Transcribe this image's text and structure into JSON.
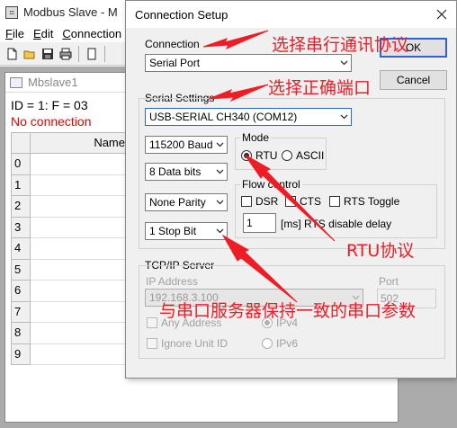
{
  "app": {
    "title": "Modbus Slave - M",
    "menu": [
      "File",
      "Edit",
      "Connection"
    ],
    "child_title": "Mbslave1",
    "status_line": "ID = 1: F = 03",
    "connection_status": "No connection",
    "grid": {
      "column_header": "Name",
      "row_indices": [
        "0",
        "1",
        "2",
        "3",
        "4",
        "5",
        "6",
        "7",
        "8",
        "9"
      ]
    }
  },
  "dialog": {
    "title": "Connection Setup",
    "connection_label": "Connection",
    "connection_value": "Serial Port",
    "ok_label": "OK",
    "cancel_label": "Cancel",
    "serial_settings_label": "Serial Settings",
    "port_value": "USB-SERIAL CH340 (COM12)",
    "baud_value": "115200 Baud",
    "data_bits_value": "8 Data bits",
    "parity_value": "None Parity",
    "stop_bits_value": "1 Stop Bit",
    "mode": {
      "label": "Mode",
      "rtu_label": "RTU",
      "ascii_label": "ASCII",
      "selected": "RTU"
    },
    "flow_control": {
      "label": "Flow control",
      "dsr_label": "DSR",
      "cts_label": "CTS",
      "rts_toggle_label": "RTS Toggle",
      "delay_value": "1",
      "delay_suffix": "[ms] RTS disable delay"
    },
    "tcpip": {
      "label": "TCP/IP Server",
      "ip_label": "IP Address",
      "ip_value": "192.168.3.100",
      "port_label": "Port",
      "port_value": "502",
      "any_address_label": "Any Address",
      "ignore_unit_id_label": "Ignore Unit ID",
      "ipv4_label": "IPv4",
      "ipv6_label": "IPv6"
    }
  },
  "annotations": {
    "select_protocol": "选择串行通讯协议",
    "select_port": "选择正确端口",
    "rtu_protocol": "RTU协议",
    "match_server": "与串口服务器保持一致的串口参数",
    "color": "#ee1c25"
  }
}
